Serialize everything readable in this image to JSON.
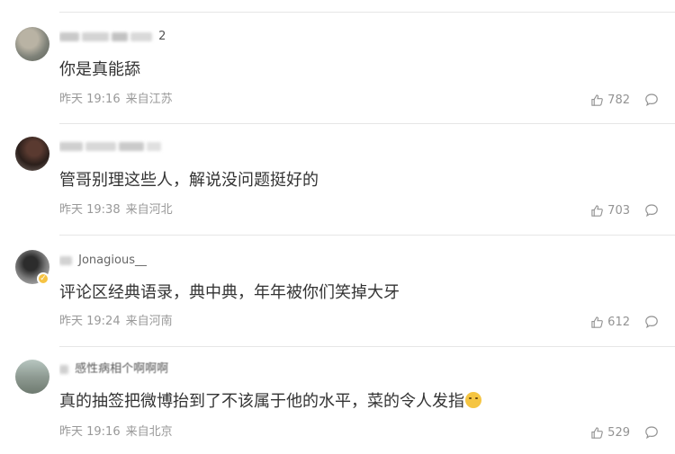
{
  "comments": [
    {
      "username_tail": "2",
      "text": "你是真能舔",
      "time": "昨天 19:16",
      "location": "来自江苏",
      "likes": "782",
      "avatar_color": "#8a8f86",
      "badge": false,
      "has_emoji": false
    },
    {
      "username_tail": "",
      "text": "管哥别理这些人，解说没问题挺好的",
      "time": "昨天 19:38",
      "location": "来自河北",
      "likes": "703",
      "avatar_color": "#3a2a24",
      "badge": false,
      "has_emoji": false
    },
    {
      "username_tail": "Jonagious__",
      "text": "评论区经典语录，典中典，年年被你们笑掉大牙",
      "time": "昨天 19:24",
      "location": "来自河南",
      "likes": "612",
      "avatar_color": "#6f6f6f",
      "badge": true,
      "has_emoji": false
    },
    {
      "username_tail": "感性病相个啊啊啊",
      "text": "真的抽签把微博抬到了不该属于他的水平，菜的令人发指",
      "time": "昨天 19:16",
      "location": "来自北京",
      "likes": "529",
      "avatar_color": "#9aa39a",
      "badge": false,
      "has_emoji": true
    }
  ],
  "icons": {
    "like": "thumbs-up-icon",
    "reply": "comment-bubble-icon"
  },
  "colors": {
    "meta": "#999999",
    "text": "#333333",
    "divider": "#e6e6e6",
    "badge": "#f6c343"
  }
}
